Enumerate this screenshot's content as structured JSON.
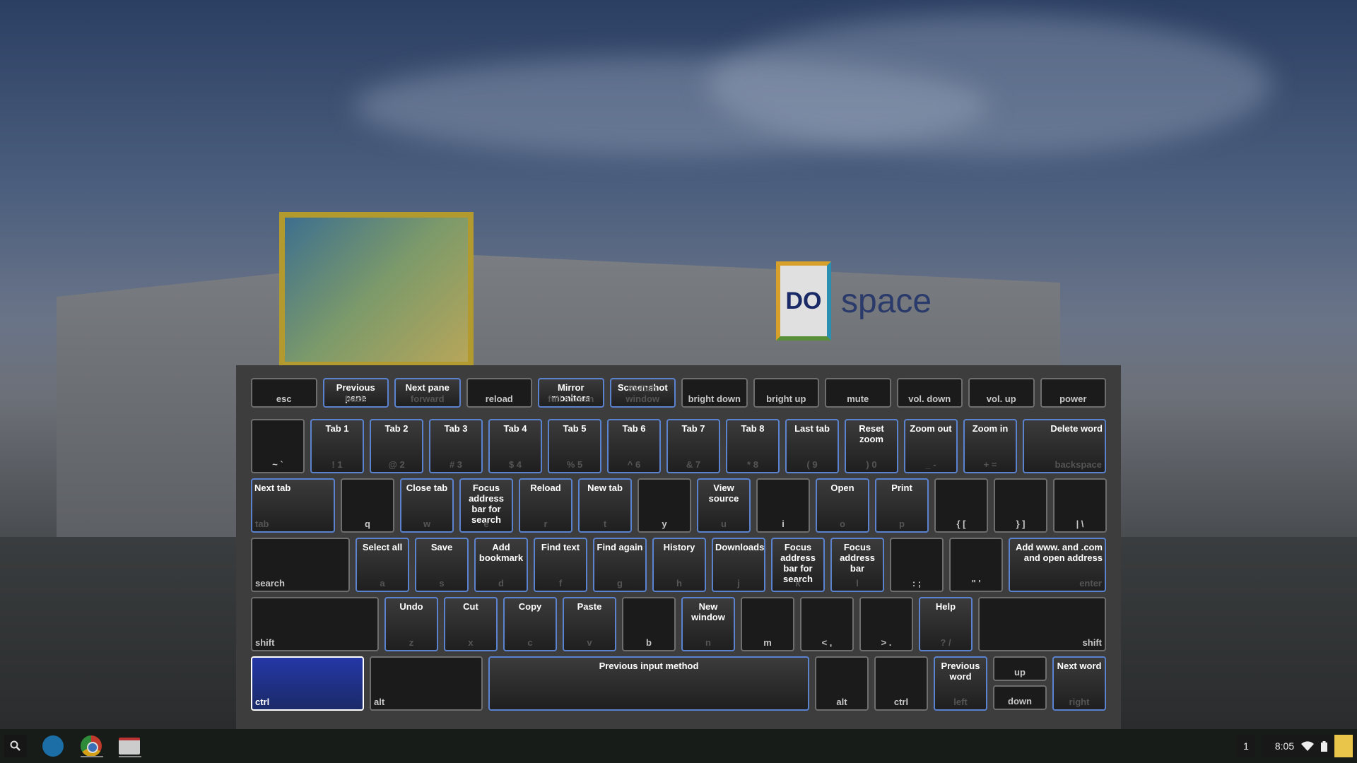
{
  "wallpaper": {
    "sign_logo": "DO",
    "sign_text": "space"
  },
  "keyboard": {
    "rows": [
      [
        {
          "top": "",
          "bottom": "esc"
        },
        {
          "top": "Previous pane",
          "bottom": "back",
          "active": true
        },
        {
          "top": "Next pane",
          "bottom": "forward",
          "active": true
        },
        {
          "top": "",
          "bottom": "reload"
        },
        {
          "top": "Mirror monitors",
          "bottom": "full screen",
          "active": true
        },
        {
          "top": "Screenshot",
          "bottom": "switch window",
          "active": true
        },
        {
          "top": "",
          "bottom": "bright down"
        },
        {
          "top": "",
          "bottom": "bright up"
        },
        {
          "top": "",
          "bottom": "mute"
        },
        {
          "top": "",
          "bottom": "vol. down"
        },
        {
          "top": "",
          "bottom": "vol. up"
        },
        {
          "top": "",
          "bottom": "power"
        }
      ],
      [
        {
          "top": "",
          "bottom": "~ `"
        },
        {
          "top": "Tab 1",
          "bottom": "! 1",
          "active": true
        },
        {
          "top": "Tab 2",
          "bottom": "@ 2",
          "active": true
        },
        {
          "top": "Tab 3",
          "bottom": "# 3",
          "active": true
        },
        {
          "top": "Tab 4",
          "bottom": "$ 4",
          "active": true
        },
        {
          "top": "Tab 5",
          "bottom": "% 5",
          "active": true
        },
        {
          "top": "Tab 6",
          "bottom": "^ 6",
          "active": true
        },
        {
          "top": "Tab 7",
          "bottom": "& 7",
          "active": true
        },
        {
          "top": "Tab 8",
          "bottom": "* 8",
          "active": true
        },
        {
          "top": "Last tab",
          "bottom": "( 9",
          "active": true
        },
        {
          "top": "Reset zoom",
          "bottom": ") 0",
          "active": true
        },
        {
          "top": "Zoom out",
          "bottom": "_ -",
          "active": true
        },
        {
          "top": "Zoom in",
          "bottom": "+ =",
          "active": true
        },
        {
          "top": "Delete word",
          "bottom": "backspace",
          "active": true
        }
      ],
      [
        {
          "top": "Next tab",
          "bottom": "tab",
          "active": true
        },
        {
          "top": "",
          "bottom": "q"
        },
        {
          "top": "Close tab",
          "bottom": "w",
          "active": true
        },
        {
          "top": "Focus address bar for search",
          "bottom": "e",
          "active": true
        },
        {
          "top": "Reload",
          "bottom": "r",
          "active": true
        },
        {
          "top": "New tab",
          "bottom": "t",
          "active": true
        },
        {
          "top": "",
          "bottom": "y"
        },
        {
          "top": "View source",
          "bottom": "u",
          "active": true
        },
        {
          "top": "",
          "bottom": "i"
        },
        {
          "top": "Open",
          "bottom": "o",
          "active": true
        },
        {
          "top": "Print",
          "bottom": "p",
          "active": true
        },
        {
          "top": "",
          "bottom": "{ ["
        },
        {
          "top": "",
          "bottom": "} ]"
        },
        {
          "top": "",
          "bottom": "| \\"
        }
      ],
      [
        {
          "top": "",
          "bottom": "search"
        },
        {
          "top": "Select all",
          "bottom": "a",
          "active": true
        },
        {
          "top": "Save",
          "bottom": "s",
          "active": true
        },
        {
          "top": "Add bookmark",
          "bottom": "d",
          "active": true
        },
        {
          "top": "Find text",
          "bottom": "f",
          "active": true
        },
        {
          "top": "Find again",
          "bottom": "g",
          "active": true
        },
        {
          "top": "History",
          "bottom": "h",
          "active": true
        },
        {
          "top": "Downloads",
          "bottom": "j",
          "active": true
        },
        {
          "top": "Focus address bar for search",
          "bottom": "k",
          "active": true
        },
        {
          "top": "Focus address bar",
          "bottom": "l",
          "active": true
        },
        {
          "top": "",
          "bottom": ": ;"
        },
        {
          "top": "",
          "bottom": "\" '"
        },
        {
          "top": "Add www. and .com and open address",
          "bottom": "enter",
          "active": true
        }
      ],
      [
        {
          "top": "",
          "bottom": "shift"
        },
        {
          "top": "Undo",
          "bottom": "z",
          "active": true
        },
        {
          "top": "Cut",
          "bottom": "x",
          "active": true
        },
        {
          "top": "Copy",
          "bottom": "c",
          "active": true
        },
        {
          "top": "Paste",
          "bottom": "v",
          "active": true
        },
        {
          "top": "",
          "bottom": "b"
        },
        {
          "top": "New window",
          "bottom": "n",
          "active": true
        },
        {
          "top": "",
          "bottom": "m"
        },
        {
          "top": "",
          "bottom": "< ,"
        },
        {
          "top": "",
          "bottom": "> ."
        },
        {
          "top": "Help",
          "bottom": "? /",
          "active": true
        },
        {
          "top": "",
          "bottom": "shift"
        }
      ],
      [
        {
          "top": "",
          "bottom": "ctrl",
          "pressed": true
        },
        {
          "top": "",
          "bottom": "alt"
        },
        {
          "top": "Previous input method",
          "bottom": "",
          "active": true
        },
        {
          "top": "",
          "bottom": "alt"
        },
        {
          "top": "",
          "bottom": "ctrl"
        },
        {
          "top": "Previous word",
          "bottom": "left",
          "active": true
        },
        {
          "top": "",
          "bottom": "up"
        },
        {
          "top": "",
          "bottom": "down"
        },
        {
          "top": "Next word",
          "bottom": "right",
          "active": true
        }
      ]
    ]
  },
  "shelf": {
    "apps": [
      "search-icon",
      "files-icon",
      "chrome-icon",
      "gmail-icon"
    ],
    "desk_number": "1",
    "time": "8:05",
    "colors": {
      "active_border": "#5b82cf",
      "pressed": "#2437a6"
    }
  }
}
